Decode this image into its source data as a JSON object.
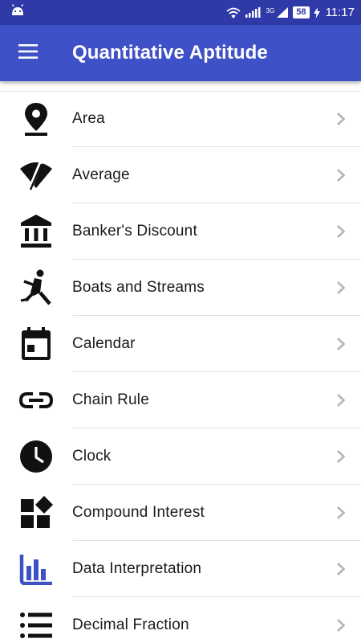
{
  "status_bar": {
    "network_label": "3G",
    "battery": "58",
    "time": "11:17",
    "icons": [
      "android-icon",
      "wifi-icon",
      "signal-icon",
      "battery-icon",
      "charging-icon"
    ]
  },
  "app_bar": {
    "title": "Quantitative Aptitude",
    "menu_icon": "hamburger-menu-icon"
  },
  "colors": {
    "status_bar": "#2f3aa8",
    "app_bar": "#3f51c6",
    "icon": "#111111",
    "chart_icon": "#3f51c6",
    "chevron": "#b5b5b5"
  },
  "topics": [
    {
      "label": "Area",
      "icon": "map-pin-icon"
    },
    {
      "label": "Average",
      "icon": "wifi-off-icon"
    },
    {
      "label": "Banker's Discount",
      "icon": "bank-icon"
    },
    {
      "label": "Boats and Streams",
      "icon": "rowing-icon"
    },
    {
      "label": "Calendar",
      "icon": "calendar-icon"
    },
    {
      "label": "Chain Rule",
      "icon": "link-icon"
    },
    {
      "label": "Clock",
      "icon": "clock-icon"
    },
    {
      "label": "Compound Interest",
      "icon": "widgets-icon"
    },
    {
      "label": "Data Interpretation",
      "icon": "bar-chart-icon"
    },
    {
      "label": "Decimal Fraction",
      "icon": "list-icon"
    }
  ]
}
